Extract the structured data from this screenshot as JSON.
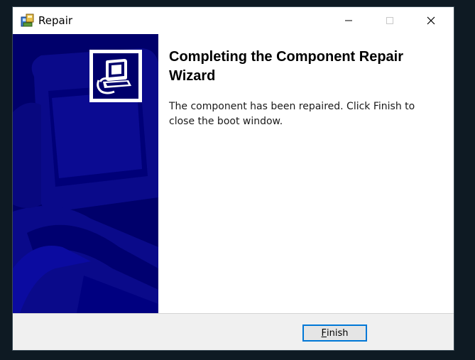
{
  "window": {
    "title": "Repair"
  },
  "titlebar_buttons": {
    "minimize_icon": "minimize-icon",
    "maximize_icon": "maximize-icon",
    "close_icon": "close-icon"
  },
  "content": {
    "heading": "Completing the Component Repair Wizard",
    "body": "The component has been repaired. Click Finish to close the boot window."
  },
  "footer": {
    "finish_label_accel": "F",
    "finish_label_rest": "inish"
  },
  "colors": {
    "sidebar": "#00006b",
    "accent_border": "#0078d7",
    "footer_bg": "#f0f0f0"
  }
}
